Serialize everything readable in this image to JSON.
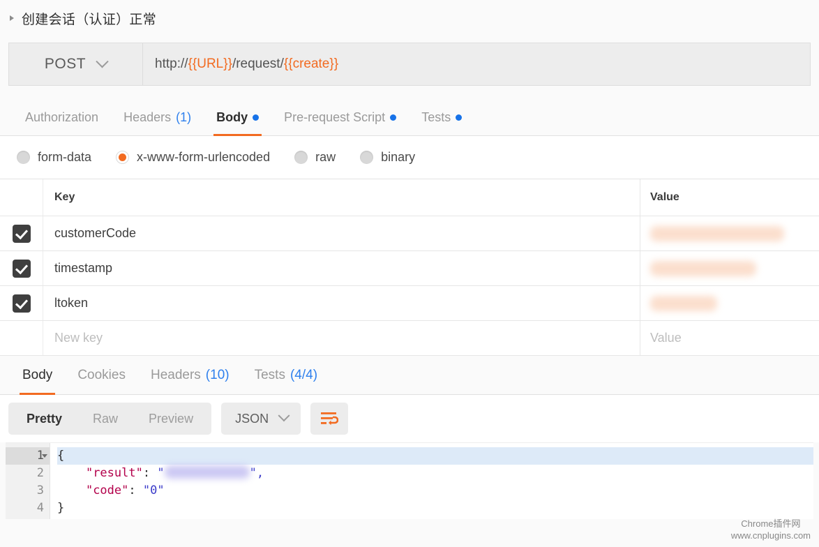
{
  "request": {
    "title": "创建会话（认证）正常",
    "fold_icon": "triangle-right-icon",
    "method": "POST",
    "method_chevron_icon": "chevron-down-icon",
    "url_parts": [
      {
        "text": "http://",
        "kind": "plain"
      },
      {
        "text": "{{URL}}",
        "kind": "variable"
      },
      {
        "text": "/request/",
        "kind": "plain"
      },
      {
        "text": "{{create}}",
        "kind": "variable"
      }
    ],
    "url_full": "http://{{URL}}/request/{{create}}",
    "tabs": [
      {
        "label": "Authorization",
        "count": "",
        "dot": false,
        "active": false
      },
      {
        "label": "Headers",
        "count": "(1)",
        "dot": false,
        "active": false
      },
      {
        "label": "Body",
        "count": "",
        "dot": true,
        "active": true
      },
      {
        "label": "Pre-request Script",
        "count": "",
        "dot": true,
        "active": false
      },
      {
        "label": "Tests",
        "count": "",
        "dot": true,
        "active": false
      }
    ],
    "body_types": [
      {
        "label": "form-data",
        "selected": false
      },
      {
        "label": "x-www-form-urlencoded",
        "selected": true
      },
      {
        "label": "raw",
        "selected": false
      },
      {
        "label": "binary",
        "selected": false
      }
    ],
    "table": {
      "headers": {
        "key": "Key",
        "value": "Value"
      },
      "rows": [
        {
          "checked": true,
          "key": "customerCode",
          "value": "",
          "redacted": true,
          "redact_width": 192
        },
        {
          "checked": true,
          "key": "timestamp",
          "value": "",
          "redacted": true,
          "redact_width": 152
        },
        {
          "checked": true,
          "key": "ltoken",
          "value": "",
          "redacted": true,
          "redact_width": 96
        }
      ],
      "new_row": {
        "key_placeholder": "New key",
        "value_placeholder": "Value"
      }
    }
  },
  "response": {
    "tabs": [
      {
        "label": "Body",
        "count": "",
        "active": true
      },
      {
        "label": "Cookies",
        "count": "",
        "active": false
      },
      {
        "label": "Headers",
        "count": "(10)",
        "active": false
      },
      {
        "label": "Tests",
        "count": "(4/4)",
        "active": false
      }
    ],
    "view_modes": [
      {
        "label": "Pretty",
        "active": true
      },
      {
        "label": "Raw",
        "active": false
      },
      {
        "label": "Preview",
        "active": false
      }
    ],
    "format": {
      "label": "JSON",
      "chevron_icon": "chevron-down-icon"
    },
    "wrap_button_icon": "word-wrap-icon",
    "code": {
      "lines": [
        {
          "number": "1",
          "foldable": true,
          "highlighted": true,
          "tokens": [
            {
              "text": "{",
              "kind": "punc"
            }
          ]
        },
        {
          "number": "2",
          "foldable": false,
          "highlighted": false,
          "tokens": [
            {
              "text": "    ",
              "kind": "punc"
            },
            {
              "text": "\"result\"",
              "kind": "key"
            },
            {
              "text": ": ",
              "kind": "punc"
            },
            {
              "text": "\"",
              "kind": "str"
            },
            {
              "text": "",
              "kind": "redact"
            },
            {
              "text": "\",",
              "kind": "str"
            }
          ]
        },
        {
          "number": "3",
          "foldable": false,
          "highlighted": false,
          "tokens": [
            {
              "text": "    ",
              "kind": "punc"
            },
            {
              "text": "\"code\"",
              "kind": "key"
            },
            {
              "text": ": ",
              "kind": "punc"
            },
            {
              "text": "\"0\"",
              "kind": "str"
            }
          ]
        },
        {
          "number": "4",
          "foldable": false,
          "highlighted": false,
          "tokens": [
            {
              "text": "}",
              "kind": "punc"
            }
          ]
        }
      ]
    }
  },
  "watermark": {
    "line1": "Chrome插件网",
    "line2": "www.cnplugins.com"
  },
  "colors": {
    "accent_orange": "#f26b21",
    "link_blue": "#2f80ed",
    "dot_blue": "#1772e8",
    "redact_peach": "#fbdcc9",
    "redact_lavender": "#c6c2f2",
    "json_key": "#b3004b",
    "json_string": "#3b3bc9"
  }
}
